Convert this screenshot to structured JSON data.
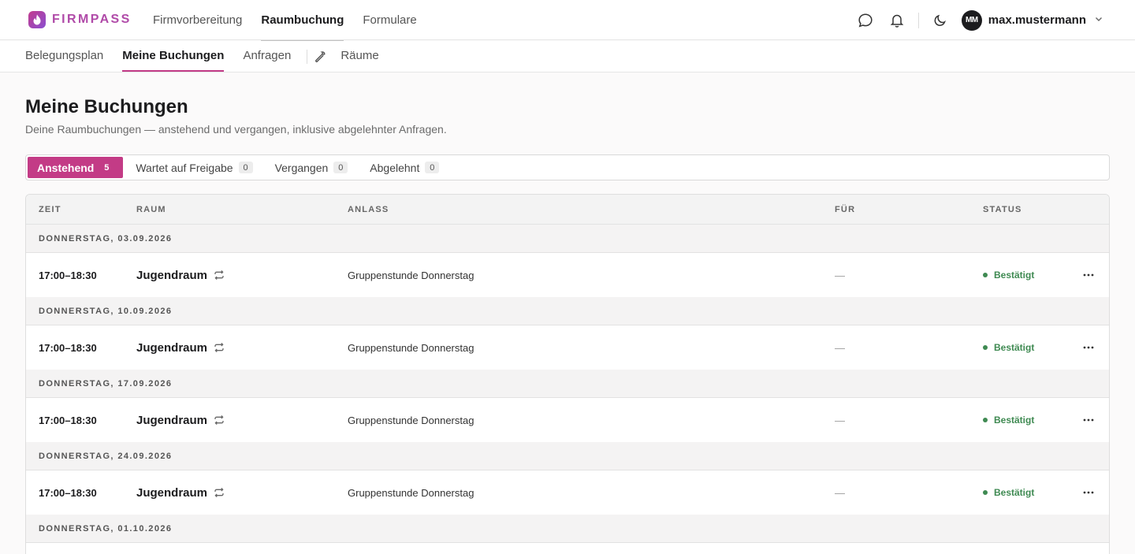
{
  "brand": {
    "name": "FIRMPASS",
    "accent": "#c33b86"
  },
  "mainnav": [
    {
      "label": "Firmvorbereitung",
      "active": false
    },
    {
      "label": "Raumbuchung",
      "active": true
    },
    {
      "label": "Formulare",
      "active": false
    }
  ],
  "user": {
    "initials": "MM",
    "name": "max.mustermann"
  },
  "subnav": {
    "items": [
      {
        "label": "Belegungsplan",
        "active": false
      },
      {
        "label": "Meine Buchungen",
        "active": true
      },
      {
        "label": "Anfragen",
        "active": false
      }
    ],
    "rooms_label": "Räume"
  },
  "page": {
    "title": "Meine Buchungen",
    "subtitle": "Deine Raumbuchungen — anstehend und vergangen, inklusive abgelehnter Anfragen."
  },
  "tabs": [
    {
      "label": "Anstehend",
      "count": "5",
      "active": true
    },
    {
      "label": "Wartet auf Freigabe",
      "count": "0",
      "active": false
    },
    {
      "label": "Vergangen",
      "count": "0",
      "active": false
    },
    {
      "label": "Abgelehnt",
      "count": "0",
      "active": false
    }
  ],
  "table": {
    "columns": {
      "time": "ZEIT",
      "room": "RAUM",
      "purpose": "ANLASS",
      "for": "FÜR",
      "status": "STATUS"
    },
    "groups": [
      {
        "date": "DONNERSTAG, 03.09.2026",
        "rows": [
          {
            "time": "17:00–18:30",
            "room": "Jugendraum",
            "purpose": "Gruppenstunde Donnerstag",
            "for": "—",
            "status": "Bestätigt"
          }
        ]
      },
      {
        "date": "DONNERSTAG, 10.09.2026",
        "rows": [
          {
            "time": "17:00–18:30",
            "room": "Jugendraum",
            "purpose": "Gruppenstunde Donnerstag",
            "for": "—",
            "status": "Bestätigt"
          }
        ]
      },
      {
        "date": "DONNERSTAG, 17.09.2026",
        "rows": [
          {
            "time": "17:00–18:30",
            "room": "Jugendraum",
            "purpose": "Gruppenstunde Donnerstag",
            "for": "—",
            "status": "Bestätigt"
          }
        ]
      },
      {
        "date": "DONNERSTAG, 24.09.2026",
        "rows": [
          {
            "time": "17:00–18:30",
            "room": "Jugendraum",
            "purpose": "Gruppenstunde Donnerstag",
            "for": "—",
            "status": "Bestätigt"
          }
        ]
      },
      {
        "date": "DONNERSTAG, 01.10.2026",
        "rows": []
      }
    ]
  }
}
